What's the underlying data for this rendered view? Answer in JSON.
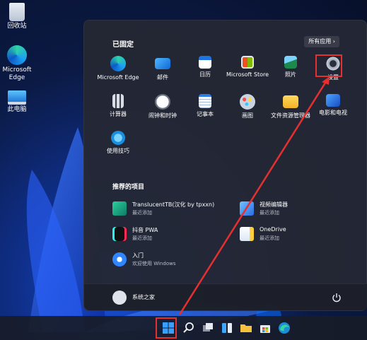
{
  "desktop": {
    "icons": [
      {
        "label": "回收站",
        "icon": "recycle-bin-icon"
      },
      {
        "label": "Microsoft Edge",
        "icon": "edge-icon"
      },
      {
        "label": "此电脑",
        "icon": "computer-icon"
      }
    ]
  },
  "start_menu": {
    "pinned_title": "已固定",
    "all_apps_label": "所有应用",
    "all_apps_chevron": "›",
    "pinned": [
      {
        "label": "Microsoft Edge",
        "icon": "edge-icon"
      },
      {
        "label": "邮件",
        "icon": "mail-icon"
      },
      {
        "label": "日历",
        "icon": "calendar-icon"
      },
      {
        "label": "Microsoft Store",
        "icon": "store-icon"
      },
      {
        "label": "照片",
        "icon": "photos-icon"
      },
      {
        "label": "设置",
        "icon": "gear-icon"
      },
      {
        "label": "计算器",
        "icon": "calculator-icon"
      },
      {
        "label": "闹钟和时钟",
        "icon": "clock-icon"
      },
      {
        "label": "记事本",
        "icon": "notepad-icon"
      },
      {
        "label": "画图",
        "icon": "paint-icon"
      },
      {
        "label": "文件资源管理器",
        "icon": "folder-icon"
      },
      {
        "label": "电影和电视",
        "icon": "movies-icon"
      },
      {
        "label": "使用技巧",
        "icon": "tips-icon"
      }
    ],
    "recommended_title": "推荐的项目",
    "recommended": [
      {
        "name": "TranslucentTB(汉化 by tpxxn)",
        "sub": "最近添加",
        "icon": "translucenttb-icon"
      },
      {
        "name": "视频编辑器",
        "sub": "最近添加",
        "icon": "video-editor-icon"
      },
      {
        "name": "抖音 PWA",
        "sub": "最近添加",
        "icon": "douyin-icon"
      },
      {
        "name": "OneDrive",
        "sub": "最近添加",
        "icon": "onedrive-icon"
      },
      {
        "name": "入门",
        "sub": "欢迎使用 Windows",
        "icon": "getstarted-icon"
      }
    ],
    "user_name": "系统之家"
  },
  "taskbar": {
    "items": [
      "start-icon",
      "search-icon",
      "task-view-icon",
      "widgets-icon",
      "file-explorer-icon",
      "store-icon",
      "edge-icon"
    ]
  },
  "colors": {
    "highlight": "#e53030",
    "menu_bg": "#242834"
  }
}
